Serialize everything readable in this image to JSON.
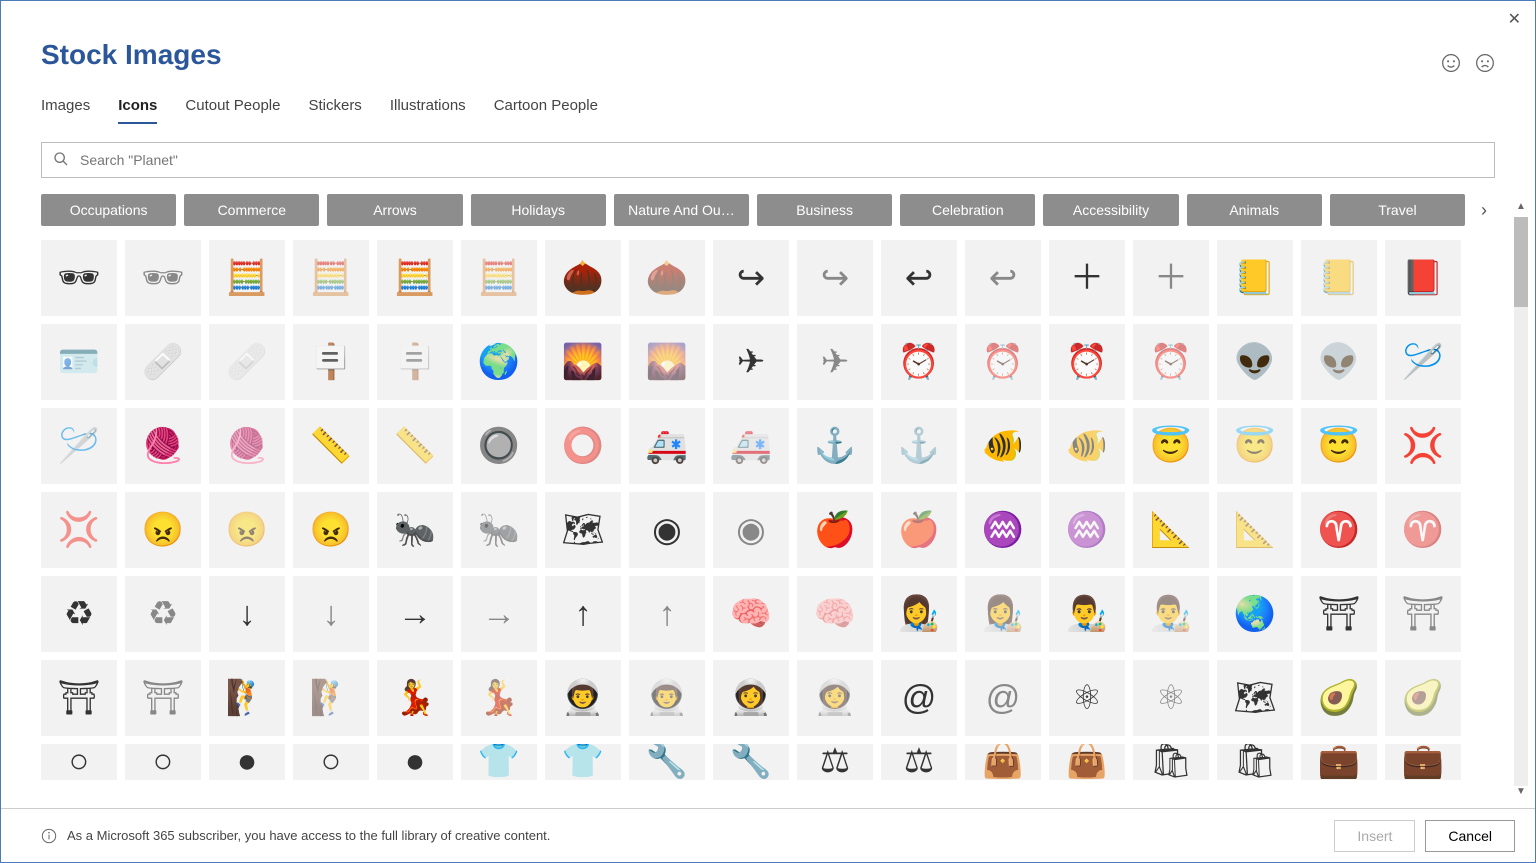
{
  "title": "Stock Images",
  "tabs": [
    "Images",
    "Icons",
    "Cutout People",
    "Stickers",
    "Illustrations",
    "Cartoon People"
  ],
  "active_tab": 1,
  "search_placeholder": "Search \"Planet\"",
  "categories": [
    "Occupations",
    "Commerce",
    "Arrows",
    "Holidays",
    "Nature And Ou…",
    "Business",
    "Celebration",
    "Accessibility",
    "Animals",
    "Travel"
  ],
  "footer_text": "As a Microsoft 365 subscriber, you have access to the full library of creative content.",
  "insert_label": "Insert",
  "cancel_label": "Cancel",
  "icons": [
    {
      "name": "3d-glasses-solid",
      "g": "🕶"
    },
    {
      "name": "3d-glasses-outline",
      "g": "🕶"
    },
    {
      "name": "abacus-solid",
      "g": "🧮"
    },
    {
      "name": "abacus-outline",
      "g": "🧮"
    },
    {
      "name": "abacus-alt-solid",
      "g": "🧮"
    },
    {
      "name": "abacus-alt-outline",
      "g": "🧮"
    },
    {
      "name": "acorn-solid",
      "g": "🌰"
    },
    {
      "name": "acorn-outline",
      "g": "🌰"
    },
    {
      "name": "arrow-curve-right-solid",
      "g": "↪"
    },
    {
      "name": "arrow-curve-right-outline",
      "g": "↪"
    },
    {
      "name": "arrow-curve-left-solid",
      "g": "↩"
    },
    {
      "name": "arrow-curve-left-outline",
      "g": "↩"
    },
    {
      "name": "add-solid",
      "g": "＋"
    },
    {
      "name": "add-outline",
      "g": "＋"
    },
    {
      "name": "address-book-solid",
      "g": "📒"
    },
    {
      "name": "address-book-outline",
      "g": "📒"
    },
    {
      "name": "address-book-alt",
      "g": "📕"
    },
    {
      "name": "address-card-outline",
      "g": "🪪"
    },
    {
      "name": "bandage-solid",
      "g": "🩹"
    },
    {
      "name": "bandage-outline",
      "g": "🩹"
    },
    {
      "name": "billboard-solid",
      "g": "🪧"
    },
    {
      "name": "billboard-outline",
      "g": "🪧"
    },
    {
      "name": "africa-solid",
      "g": "🌍"
    },
    {
      "name": "agriculture-solid",
      "g": "🌄"
    },
    {
      "name": "agriculture-outline",
      "g": "🌄"
    },
    {
      "name": "airplane-solid",
      "g": "✈"
    },
    {
      "name": "airplane-outline",
      "g": "✈"
    },
    {
      "name": "alarm-clock-solid",
      "g": "⏰"
    },
    {
      "name": "alarm-clock-outline",
      "g": "⏰"
    },
    {
      "name": "alarm-clock-alt-solid",
      "g": "⏰"
    },
    {
      "name": "alarm-clock-alt-outline",
      "g": "⏰"
    },
    {
      "name": "alien-solid",
      "g": "👽"
    },
    {
      "name": "alien-outline",
      "g": "👽"
    },
    {
      "name": "needle-solid",
      "g": "🪡"
    },
    {
      "name": "needle-outline",
      "g": "🪡"
    },
    {
      "name": "yarn-solid",
      "g": "🧶"
    },
    {
      "name": "yarn-outline",
      "g": "🧶"
    },
    {
      "name": "tape-measure-solid",
      "g": "📏"
    },
    {
      "name": "tape-measure-outline",
      "g": "📏"
    },
    {
      "name": "button-solid",
      "g": "🔘"
    },
    {
      "name": "button-outline",
      "g": "⭕"
    },
    {
      "name": "ambulance-solid",
      "g": "🚑"
    },
    {
      "name": "ambulance-outline",
      "g": "🚑"
    },
    {
      "name": "anchor-solid",
      "g": "⚓"
    },
    {
      "name": "anchor-outline",
      "g": "⚓"
    },
    {
      "name": "anemone-solid",
      "g": "🐠"
    },
    {
      "name": "anemone-outline",
      "g": "🐠"
    },
    {
      "name": "angel-face-solid",
      "g": "😇"
    },
    {
      "name": "angel-face-outline",
      "g": "😇"
    },
    {
      "name": "angel-face-alt",
      "g": "😇"
    },
    {
      "name": "anger-symbol-solid",
      "g": "💢"
    },
    {
      "name": "anger-symbol-outline",
      "g": "💢"
    },
    {
      "name": "angry-face-solid",
      "g": "😠"
    },
    {
      "name": "angry-face-outline",
      "g": "😠"
    },
    {
      "name": "angry-face-alt",
      "g": "😠"
    },
    {
      "name": "ant-solid",
      "g": "🐜"
    },
    {
      "name": "ant-outline",
      "g": "🐜"
    },
    {
      "name": "antarctica-solid",
      "g": "🗺"
    },
    {
      "name": "aperture-solid",
      "g": "◉"
    },
    {
      "name": "aperture-outline",
      "g": "◉"
    },
    {
      "name": "apple-solid",
      "g": "🍎"
    },
    {
      "name": "apple-outline",
      "g": "🍎"
    },
    {
      "name": "aquarius-solid",
      "g": "♒"
    },
    {
      "name": "aquarius-outline",
      "g": "♒"
    },
    {
      "name": "architecture-solid",
      "g": "📐"
    },
    {
      "name": "architecture-outline",
      "g": "📐"
    },
    {
      "name": "aries-solid",
      "g": "♈"
    },
    {
      "name": "aries-outline",
      "g": "♈"
    },
    {
      "name": "recycle-solid",
      "g": "♻"
    },
    {
      "name": "recycle-outline",
      "g": "♻"
    },
    {
      "name": "arrow-down-solid",
      "g": "↓"
    },
    {
      "name": "arrow-down-outline",
      "g": "↓"
    },
    {
      "name": "arrow-right-solid",
      "g": "→"
    },
    {
      "name": "arrow-right-outline",
      "g": "→"
    },
    {
      "name": "arrow-up-solid",
      "g": "↑"
    },
    {
      "name": "arrow-up-outline",
      "g": "↑"
    },
    {
      "name": "ai-head-solid",
      "g": "🧠"
    },
    {
      "name": "ai-head-outline",
      "g": "🧠"
    },
    {
      "name": "artist-solid",
      "g": "👩‍🎨"
    },
    {
      "name": "artist-outline",
      "g": "👩‍🎨"
    },
    {
      "name": "artist-alt-solid",
      "g": "👨‍🎨"
    },
    {
      "name": "artist-alt-outline",
      "g": "👨‍🎨"
    },
    {
      "name": "asia-solid",
      "g": "🌏"
    },
    {
      "name": "asian-temple-solid",
      "g": "⛩"
    },
    {
      "name": "asian-temple-outline",
      "g": "⛩"
    },
    {
      "name": "torii-solid",
      "g": "⛩"
    },
    {
      "name": "torii-outline",
      "g": "⛩"
    },
    {
      "name": "climber-solid",
      "g": "🧗"
    },
    {
      "name": "climber-outline",
      "g": "🧗"
    },
    {
      "name": "dancer-solid",
      "g": "💃"
    },
    {
      "name": "dancer-outline",
      "g": "💃"
    },
    {
      "name": "astronaut-solid",
      "g": "👨‍🚀"
    },
    {
      "name": "astronaut-outline",
      "g": "👨‍🚀"
    },
    {
      "name": "astronaut-alt-solid",
      "g": "👩‍🚀"
    },
    {
      "name": "astronaut-alt-outline",
      "g": "👩‍🚀"
    },
    {
      "name": "at-sign-solid",
      "g": "@"
    },
    {
      "name": "at-sign-outline",
      "g": "@"
    },
    {
      "name": "atom-solid",
      "g": "⚛"
    },
    {
      "name": "atom-outline",
      "g": "⚛"
    },
    {
      "name": "australia-solid",
      "g": "🗺"
    },
    {
      "name": "avocado-solid",
      "g": "🥑"
    },
    {
      "name": "avocado-outline",
      "g": "🥑"
    },
    {
      "name": "partial-1",
      "g": "○"
    },
    {
      "name": "partial-2",
      "g": "○"
    },
    {
      "name": "partial-3",
      "g": "●"
    },
    {
      "name": "partial-4",
      "g": "○"
    },
    {
      "name": "partial-5",
      "g": "●"
    },
    {
      "name": "partial-6",
      "g": "👕"
    },
    {
      "name": "partial-7",
      "g": "👕"
    },
    {
      "name": "partial-8",
      "g": "🔧"
    },
    {
      "name": "partial-9",
      "g": "🔧"
    },
    {
      "name": "partial-10",
      "g": "⚖"
    },
    {
      "name": "partial-11",
      "g": "⚖"
    },
    {
      "name": "partial-12",
      "g": "👜"
    },
    {
      "name": "partial-13",
      "g": "👜"
    },
    {
      "name": "partial-14",
      "g": "🛍"
    },
    {
      "name": "partial-15",
      "g": "🛍"
    },
    {
      "name": "partial-16",
      "g": "💼"
    },
    {
      "name": "partial-17",
      "g": "💼"
    }
  ]
}
